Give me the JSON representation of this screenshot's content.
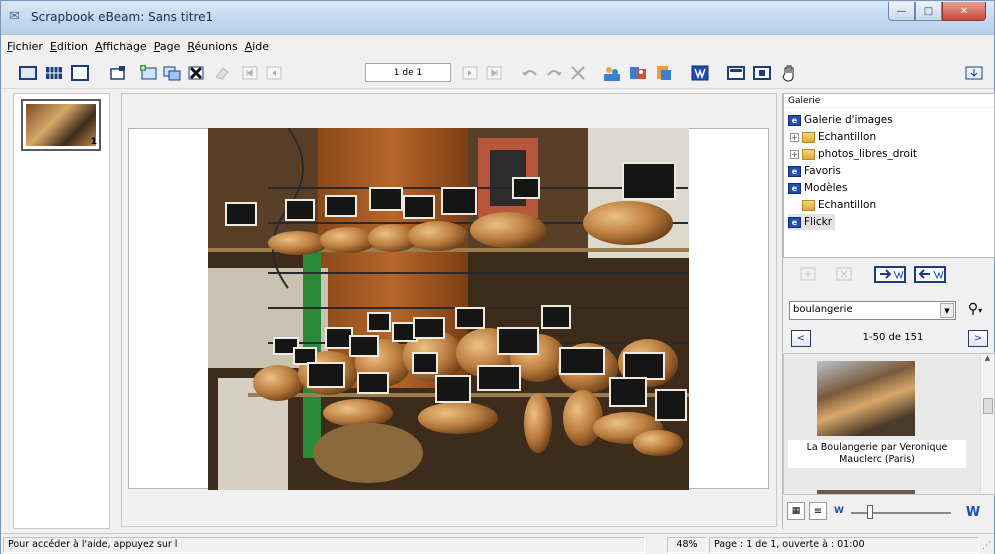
{
  "window": {
    "title": "Scrapbook eBeam: Sans titre1"
  },
  "menu": [
    "Fichier",
    "Edition",
    "Affichage",
    "Page",
    "Réunions",
    "Aide"
  ],
  "toolbar": {
    "page_indicator": "1 de 1",
    "icons": [
      "single-page-view-icon",
      "grid-view-icon",
      "full-view-icon",
      "new-page-icon",
      "add-image-icon",
      "copy-page-icon",
      "delete-page-icon",
      "eraser-icon",
      "first-page-icon",
      "prev-page-icon",
      "next-page-icon",
      "last-page-icon",
      "undo-icon",
      "redo-icon",
      "clear-icon",
      "share-users-icon",
      "meeting-icon",
      "export-icon",
      "ebeam-icon",
      "screen-icon",
      "capture-icon",
      "hand-icon",
      "dock-icon"
    ]
  },
  "left_pane": {
    "thumbnail_number": "1"
  },
  "gallery": {
    "header": "Galerie",
    "tree": [
      {
        "label": "Galerie d'images",
        "icon": "site-icon",
        "level": 0,
        "expander": ""
      },
      {
        "label": "Echantillon",
        "icon": "folder-icon",
        "level": 1,
        "expander": "+"
      },
      {
        "label": "photos_libres_droit",
        "icon": "folder-icon",
        "level": 1,
        "expander": "+"
      },
      {
        "label": "Favoris",
        "icon": "site-icon",
        "level": 0,
        "expander": ""
      },
      {
        "label": "Modèles",
        "icon": "site-icon",
        "level": 0,
        "expander": ""
      },
      {
        "label": "Echantillon",
        "icon": "folder-icon",
        "level": 1,
        "expander": ""
      },
      {
        "label": "Flickr",
        "icon": "site-icon",
        "level": 0,
        "expander": "",
        "selected": true
      }
    ],
    "search": {
      "value": "boulangerie"
    },
    "nav": {
      "prev": "<",
      "next": ">",
      "range": "1-50 de 151"
    },
    "result": {
      "caption_line1": "La Boulangerie par Veronique",
      "caption_line2": "Mauclerc (Paris)"
    }
  },
  "status": {
    "help": "Pour accéder à l'aide, appuyez sur l",
    "zoom": "48%",
    "page": "Page : 1 de 1, ouverte à : 01:00"
  },
  "colors": {
    "accent": "#1f4fb0",
    "titlebar": "#c4d7ef",
    "close": "#c7483a"
  }
}
